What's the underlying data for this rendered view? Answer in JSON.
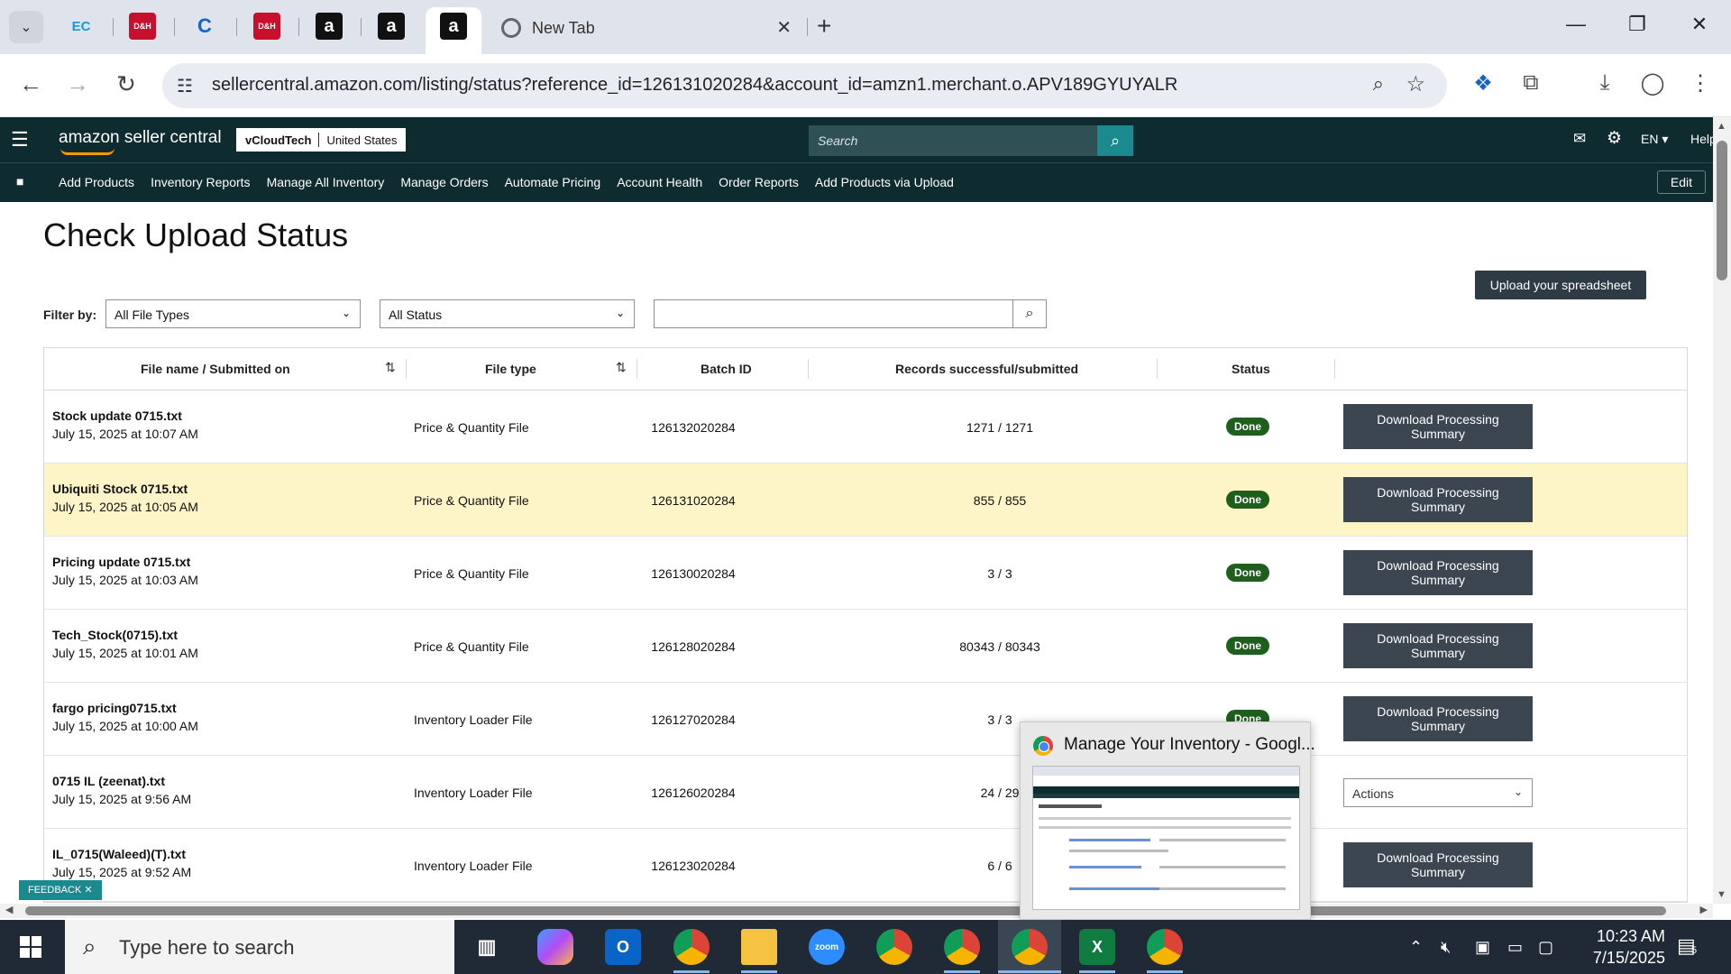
{
  "browser": {
    "active_tab_title": "New Tab",
    "url": "sellercentral.amazon.com/listing/status?reference_id=126131020284&account_id=amzn1.merchant.o.APV189GYUYALR",
    "pinned_tabs": [
      "EC",
      "D&H",
      "C",
      "D&H",
      "a",
      "a",
      "a"
    ]
  },
  "header": {
    "logo": "amazon seller central",
    "account_name": "vCloudTech",
    "account_region": "United States",
    "search_placeholder": "Search",
    "language": "EN",
    "help": "Help"
  },
  "nav": {
    "links": [
      "Add Products",
      "Inventory Reports",
      "Manage All Inventory",
      "Manage Orders",
      "Automate Pricing",
      "Account Health",
      "Order Reports",
      "Add Products via Upload"
    ],
    "edit_label": "Edit"
  },
  "page": {
    "title": "Check Upload Status",
    "upload_button": "Upload your spreadsheet",
    "filter_label": "Filter by:",
    "file_type_select": "All File Types",
    "status_select": "All Status"
  },
  "table": {
    "headers": {
      "file": "File name / Submitted on",
      "type": "File type",
      "batch": "Batch ID",
      "records": "Records successful/submitted",
      "status": "Status"
    },
    "rows": [
      {
        "name": "Stock update 0715.txt",
        "date": "July 15, 2025 at 10:07 AM",
        "type": "Price & Quantity File",
        "batch": "126132020284",
        "records": "1271 / 1271",
        "status": "Done",
        "action": "Download Processing Summary"
      },
      {
        "name": "Ubiquiti Stock 0715.txt",
        "date": "July 15, 2025 at 10:05 AM",
        "type": "Price & Quantity File",
        "batch": "126131020284",
        "records": "855 / 855",
        "status": "Done",
        "action": "Download Processing Summary"
      },
      {
        "name": "Pricing update 0715.txt",
        "date": "July 15, 2025 at 10:03 AM",
        "type": "Price & Quantity File",
        "batch": "126130020284",
        "records": "3 / 3",
        "status": "Done",
        "action": "Download Processing Summary"
      },
      {
        "name": "Tech_Stock(0715).txt",
        "date": "July 15, 2025 at 10:01 AM",
        "type": "Price & Quantity File",
        "batch": "126128020284",
        "records": "80343 / 80343",
        "status": "Done",
        "action": "Download Processing Summary"
      },
      {
        "name": "fargo pricing0715.txt",
        "date": "July 15, 2025 at 10:00 AM",
        "type": "Inventory Loader File",
        "batch": "126127020284",
        "records": "3 / 3",
        "status": "Done",
        "action": "Download Processing Summary"
      },
      {
        "name": "0715 IL (zeenat).txt",
        "date": "July 15, 2025 at 9:56 AM",
        "type": "Inventory Loader File",
        "batch": "126126020284",
        "records": "24 / 29",
        "status": "",
        "action": "Actions"
      },
      {
        "name": "IL_0715(Waleed)(T).txt",
        "date": "July 15, 2025 at 9:52 AM",
        "type": "Inventory Loader File",
        "batch": "126123020284",
        "records": "6 / 6",
        "status": "",
        "action": "Download Processing Summary"
      }
    ]
  },
  "feedback_label": "FEEDBACK",
  "preview": {
    "title": "Manage Your Inventory - Googl..."
  },
  "taskbar": {
    "search_placeholder": "Type here to search",
    "zoom_label": "zoom",
    "time": "10:23 AM",
    "date": "7/15/2025",
    "notifications": "5"
  },
  "colors": {
    "header_bg": "#0e2b30",
    "accent": "#1b8a8f",
    "done_badge": "#1e5f1e",
    "highlight_row": "#fdf4c8",
    "button_dark": "#3c4650"
  }
}
